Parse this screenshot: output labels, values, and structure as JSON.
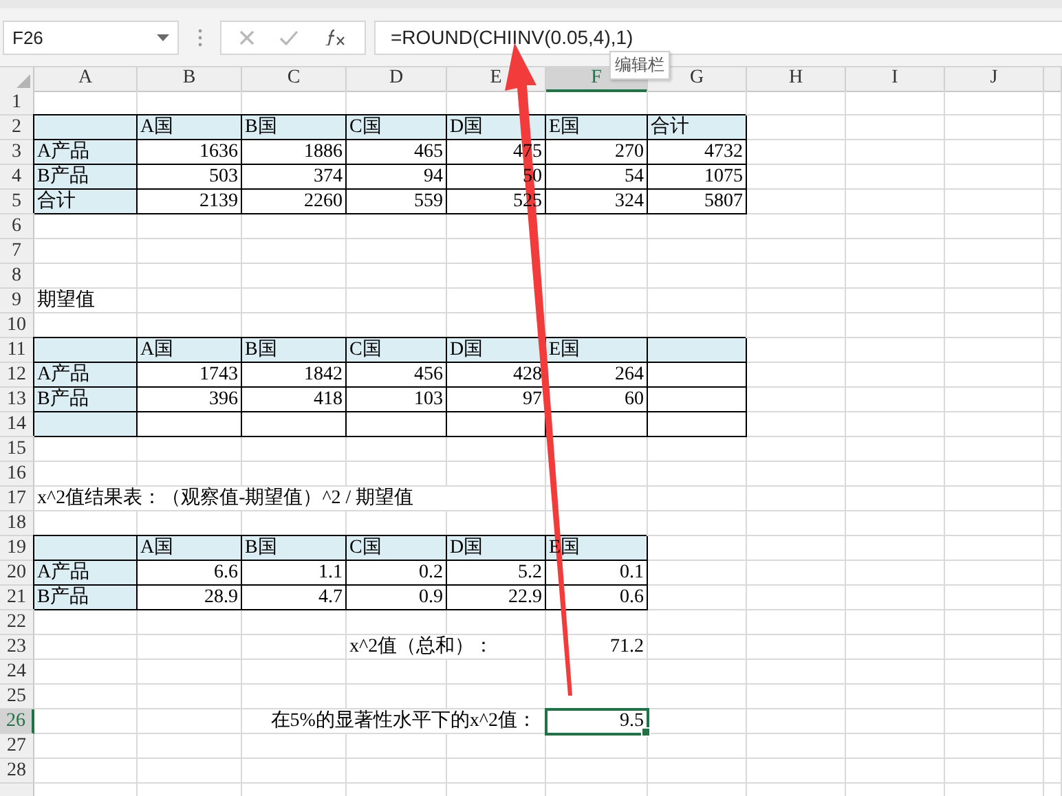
{
  "name_box": {
    "value": "F26"
  },
  "formula_bar": {
    "value": "=ROUND(CHIINV(0.05,4),1)",
    "tooltip": "编辑栏"
  },
  "columns": [
    {
      "label": "A",
      "selected": false
    },
    {
      "label": "B",
      "selected": false
    },
    {
      "label": "C",
      "selected": false
    },
    {
      "label": "D",
      "selected": false
    },
    {
      "label": "E",
      "selected": false
    },
    {
      "label": "F",
      "selected": true
    },
    {
      "label": "G",
      "selected": false
    },
    {
      "label": "H",
      "selected": false
    },
    {
      "label": "I",
      "selected": false
    },
    {
      "label": "J",
      "selected": false
    }
  ],
  "rows": [
    {
      "label": "1",
      "selected": false
    },
    {
      "label": "2",
      "selected": false,
      "cells": [
        {
          "kind": "head"
        },
        {
          "kind": "head",
          "text": "A国"
        },
        {
          "kind": "head",
          "text": "B国"
        },
        {
          "kind": "head",
          "text": "C国"
        },
        {
          "kind": "head",
          "text": "D国"
        },
        {
          "kind": "head",
          "text": "E国"
        },
        {
          "kind": "head",
          "text": "合计"
        }
      ]
    },
    {
      "label": "3",
      "selected": false,
      "cells": [
        {
          "kind": "head",
          "text": "A产品"
        },
        {
          "kind": "num",
          "text": "1636"
        },
        {
          "kind": "num",
          "text": "1886"
        },
        {
          "kind": "num",
          "text": "465"
        },
        {
          "kind": "num",
          "text": "475"
        },
        {
          "kind": "num",
          "text": "270"
        },
        {
          "kind": "num",
          "text": "4732"
        }
      ]
    },
    {
      "label": "4",
      "selected": false,
      "cells": [
        {
          "kind": "head",
          "text": "B产品"
        },
        {
          "kind": "num",
          "text": "503"
        },
        {
          "kind": "num",
          "text": "374"
        },
        {
          "kind": "num",
          "text": "94"
        },
        {
          "kind": "num",
          "text": "50"
        },
        {
          "kind": "num",
          "text": "54"
        },
        {
          "kind": "num",
          "text": "1075"
        }
      ]
    },
    {
      "label": "5",
      "selected": false,
      "cells": [
        {
          "kind": "head",
          "text": "合计"
        },
        {
          "kind": "num",
          "text": "2139"
        },
        {
          "kind": "num",
          "text": "2260"
        },
        {
          "kind": "num",
          "text": "559"
        },
        {
          "kind": "num",
          "text": "525"
        },
        {
          "kind": "num",
          "text": "324"
        },
        {
          "kind": "num",
          "text": "5807"
        }
      ]
    },
    {
      "label": "6",
      "selected": false
    },
    {
      "label": "7",
      "selected": false
    },
    {
      "label": "8",
      "selected": false
    },
    {
      "label": "9",
      "selected": false,
      "cells": [
        {
          "kind": "note",
          "text": "期望值"
        }
      ]
    },
    {
      "label": "10",
      "selected": false
    },
    {
      "label": "11",
      "selected": false,
      "cells": [
        {
          "kind": "head"
        },
        {
          "kind": "head",
          "text": "A国"
        },
        {
          "kind": "head",
          "text": "B国"
        },
        {
          "kind": "head",
          "text": "C国"
        },
        {
          "kind": "head",
          "text": "D国"
        },
        {
          "kind": "head",
          "text": "E国"
        },
        {
          "kind": "head"
        }
      ]
    },
    {
      "label": "12",
      "selected": false,
      "cells": [
        {
          "kind": "head",
          "text": "A产品"
        },
        {
          "kind": "num",
          "text": "1743"
        },
        {
          "kind": "num",
          "text": "1842"
        },
        {
          "kind": "num",
          "text": "456"
        },
        {
          "kind": "num",
          "text": "428"
        },
        {
          "kind": "num",
          "text": "264"
        },
        {
          "kind": "num"
        }
      ]
    },
    {
      "label": "13",
      "selected": false,
      "cells": [
        {
          "kind": "head",
          "text": "B产品"
        },
        {
          "kind": "num",
          "text": "396"
        },
        {
          "kind": "num",
          "text": "418"
        },
        {
          "kind": "num",
          "text": "103"
        },
        {
          "kind": "num",
          "text": "97"
        },
        {
          "kind": "num",
          "text": "60"
        },
        {
          "kind": "num"
        }
      ]
    },
    {
      "label": "14",
      "selected": false,
      "cells": [
        {
          "kind": "head"
        },
        {
          "kind": "num"
        },
        {
          "kind": "num"
        },
        {
          "kind": "num"
        },
        {
          "kind": "num"
        },
        {
          "kind": "num"
        },
        {
          "kind": "num"
        }
      ]
    },
    {
      "label": "15",
      "selected": false
    },
    {
      "label": "16",
      "selected": false
    },
    {
      "label": "17",
      "selected": false,
      "cells": [
        {
          "kind": "note",
          "text": "x^2值结果表：（观察值-期望值）^2 / 期望值"
        }
      ]
    },
    {
      "label": "18",
      "selected": false
    },
    {
      "label": "19",
      "selected": false,
      "cells": [
        {
          "kind": "head"
        },
        {
          "kind": "head",
          "text": "A国"
        },
        {
          "kind": "head",
          "text": "B国"
        },
        {
          "kind": "head",
          "text": "C国"
        },
        {
          "kind": "head",
          "text": "D国"
        },
        {
          "kind": "head",
          "text": "E国"
        }
      ]
    },
    {
      "label": "20",
      "selected": false,
      "cells": [
        {
          "kind": "head",
          "text": "A产品"
        },
        {
          "kind": "num",
          "text": "6.6"
        },
        {
          "kind": "num",
          "text": "1.1"
        },
        {
          "kind": "num",
          "text": "0.2"
        },
        {
          "kind": "num",
          "text": "5.2"
        },
        {
          "kind": "num",
          "text": "0.1"
        }
      ]
    },
    {
      "label": "21",
      "selected": false,
      "cells": [
        {
          "kind": "head",
          "text": "B产品"
        },
        {
          "kind": "num",
          "text": "28.9"
        },
        {
          "kind": "num",
          "text": "4.7"
        },
        {
          "kind": "num",
          "text": "0.9"
        },
        {
          "kind": "num",
          "text": "22.9"
        },
        {
          "kind": "num",
          "text": "0.6"
        }
      ]
    },
    {
      "label": "22",
      "selected": false
    },
    {
      "label": "23",
      "selected": false,
      "cells": [
        {
          "kind": "empty"
        },
        {
          "kind": "empty"
        },
        {
          "kind": "empty"
        },
        {
          "kind": "note",
          "text": "x^2值（总和）："
        },
        {
          "kind": "value",
          "text": "71.2"
        }
      ]
    },
    {
      "label": "24",
      "selected": false
    },
    {
      "label": "25",
      "selected": false
    },
    {
      "label": "26",
      "selected": true,
      "cells": [
        {
          "kind": "empty"
        },
        {
          "kind": "empty"
        },
        {
          "kind": "note-right",
          "text": "在5%的显著性水平下的x^2值："
        },
        {
          "kind": "value",
          "text": "9.5"
        }
      ]
    },
    {
      "label": "27",
      "selected": false
    },
    {
      "label": "28",
      "selected": false
    }
  ]
}
